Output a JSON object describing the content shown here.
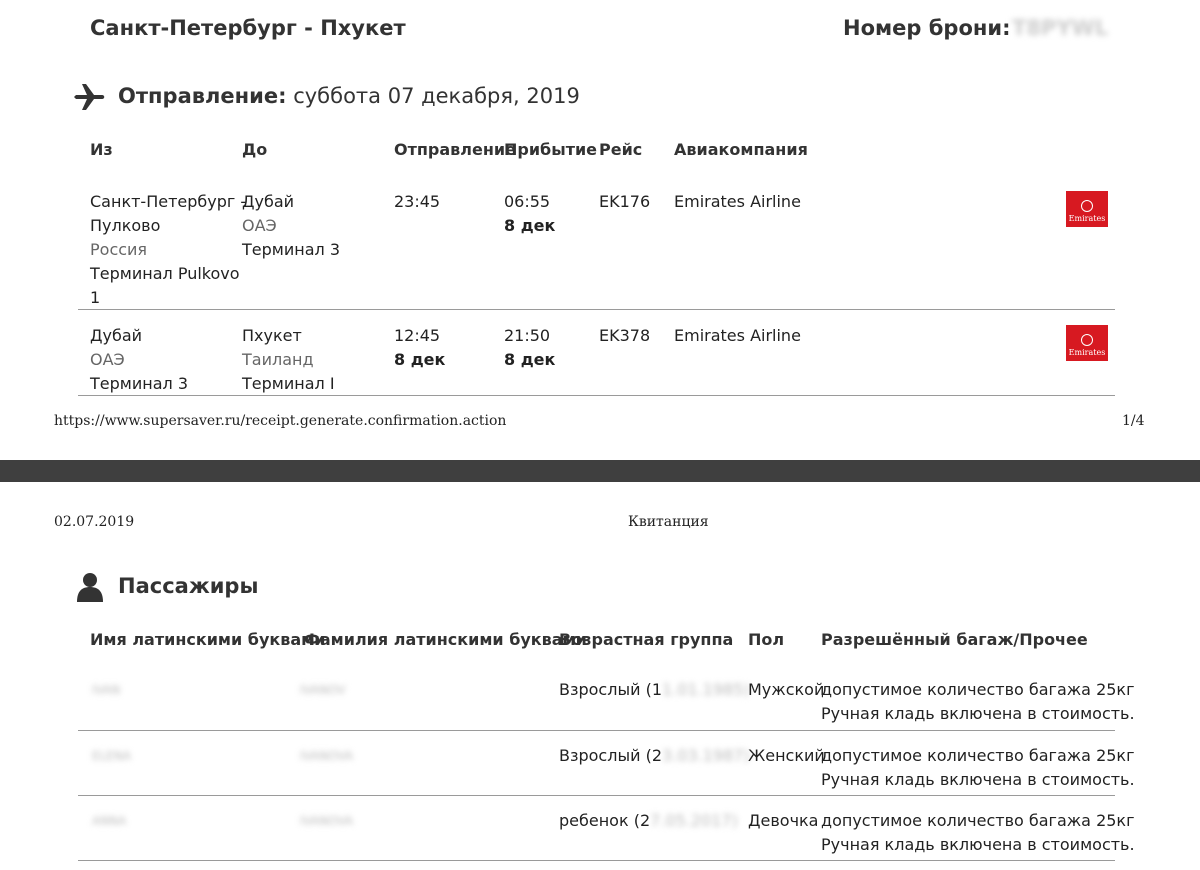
{
  "page1": {
    "route_title": "Санкт-Петербург - Пхукет",
    "booking_label": "Номер брони:",
    "booking_value": "T8PYWL",
    "departure_label": "Отправление:",
    "departure_date": "суббота 07 декабря, 2019",
    "columns": {
      "from": "Из",
      "to": "До",
      "departure": "Отправление",
      "arrival": "Прибытие",
      "flight": "Рейс",
      "airline": "Авиакомпания"
    },
    "flights": [
      {
        "from_city_line1": "Санкт-Петербург -",
        "from_city_line2": "Пулково",
        "from_country": "Россия",
        "from_terminal_line1": "Терминал Pulkovo",
        "from_terminal_line2": "1",
        "to_city": "Дубай",
        "to_country": "ОАЭ",
        "to_terminal": "Терминал 3",
        "dep_time": "23:45",
        "dep_date": "",
        "arr_time": "06:55",
        "arr_date": "8 дек",
        "flight": "EK176",
        "airline": "Emirates Airline",
        "logo_text": "Emirates"
      },
      {
        "from_city_line1": "Дубай",
        "from_country": "ОАЭ",
        "from_terminal_line1": "Терминал 3",
        "to_city": "Пхукет",
        "to_country": "Таиланд",
        "to_terminal": "Терминал I",
        "dep_time": "12:45",
        "dep_date": "8 дек",
        "arr_time": "21:50",
        "arr_date": "8 дек",
        "flight": "EK378",
        "airline": "Emirates Airline",
        "logo_text": "Emirates"
      }
    ],
    "footer_url": "https://www.supersaver.ru/receipt.generate.confirmation.action",
    "footer_page": "1/4"
  },
  "page2": {
    "header_date": "02.07.2019",
    "header_title": "Квитанция",
    "passengers_heading": "Пассажиры",
    "columns": {
      "first_name": "Имя латинскими буквами",
      "last_name": "Фамилия латинскими буквами",
      "age_group": "Возрастная группа",
      "sex": "Пол",
      "baggage": "Разрешённый багаж/Прочее"
    },
    "passengers": [
      {
        "first_name": "IVAN",
        "last_name": "IVANOV",
        "age_group": "Взрослый (1",
        "age_group_hidden": "1.01.1985)",
        "sex": "Мужской",
        "baggage_line1": "допустимое количество багажа 25кг",
        "baggage_line2": "Ручная кладь включена в стоимость."
      },
      {
        "first_name": "ELENA",
        "last_name": "IVANOVA",
        "age_group": "Взрослый (2",
        "age_group_hidden": "3.03.1987)",
        "sex": "Женский",
        "baggage_line1": "допустимое количество багажа 25кг",
        "baggage_line2": "Ручная кладь включена в стоимость."
      },
      {
        "first_name": "ANNA",
        "last_name": "IVANOVA",
        "age_group": "ребенок (2",
        "age_group_hidden": "7.05.2017)",
        "sex": "Девочка",
        "baggage_line1": "допустимое количество багажа 25кг",
        "baggage_line2": "Ручная кладь включена в стоимость."
      }
    ]
  },
  "colors": {
    "background": "#3f3f3f",
    "page": "#ffffff",
    "emirates_red": "#d71921",
    "divider": "#9a9a9a"
  },
  "icons": {
    "departure": "airplane-icon",
    "passengers": "person-icon"
  }
}
